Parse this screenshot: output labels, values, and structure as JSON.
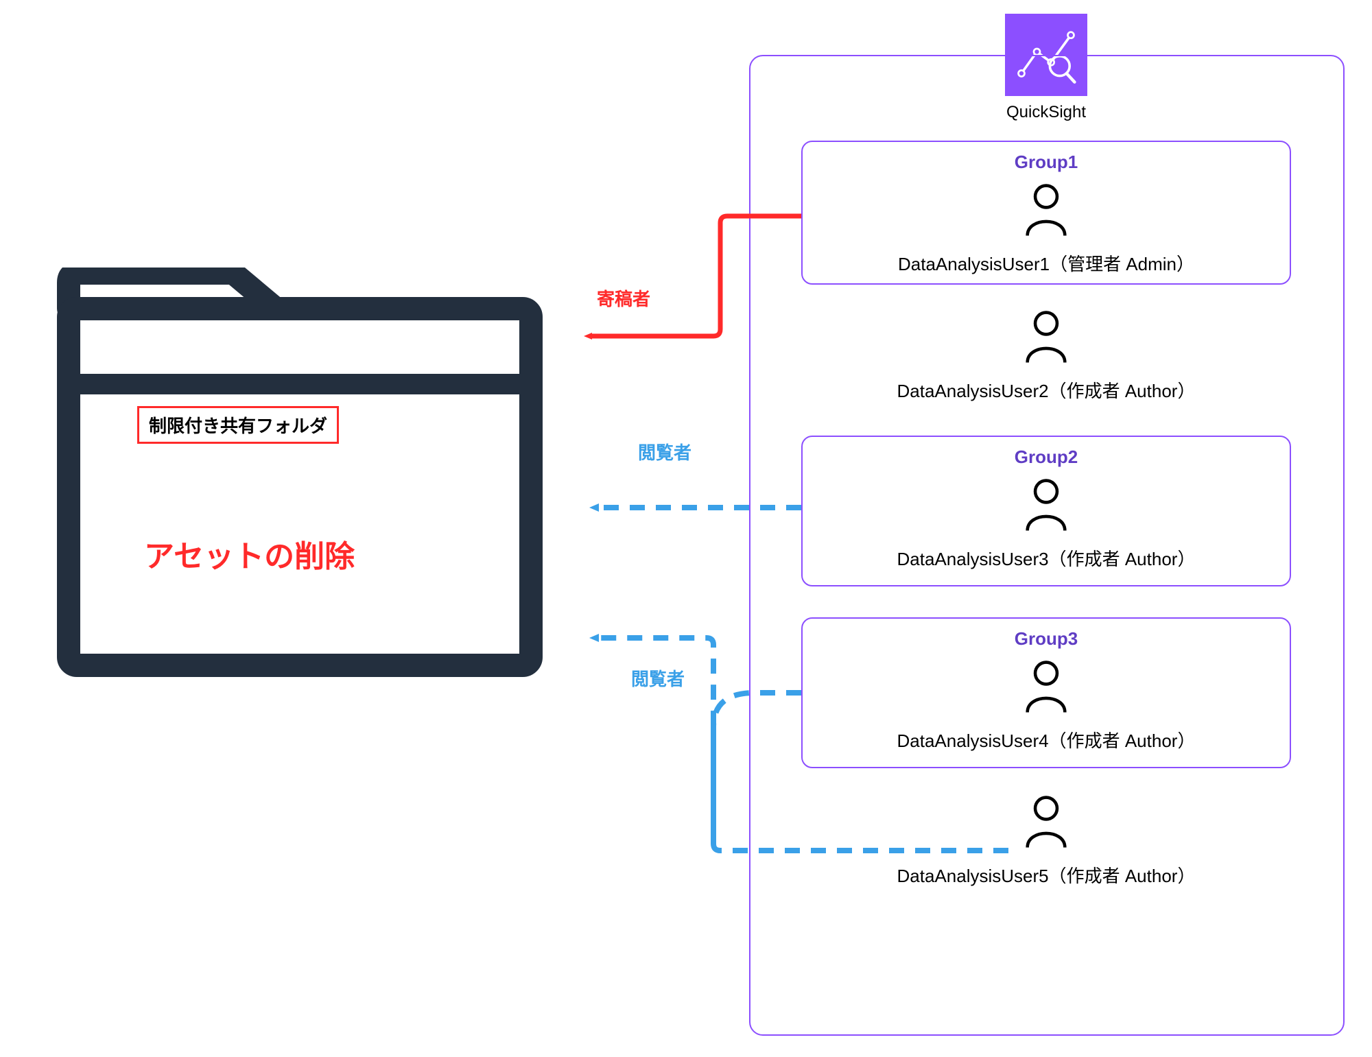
{
  "quicksight": {
    "label": "QuickSight",
    "groups": [
      {
        "title": "Group1",
        "user": "DataAnalysisUser1（管理者 Admin）"
      },
      {
        "title": "Group2",
        "user": "DataAnalysisUser3（作成者 Author）"
      },
      {
        "title": "Group3",
        "user": "DataAnalysisUser4（作成者 Author）"
      }
    ],
    "users": [
      {
        "label": "DataAnalysisUser2（作成者 Author）"
      },
      {
        "label": "DataAnalysisUser5（作成者 Author）"
      }
    ]
  },
  "folder": {
    "box_label": "制限付き共有フォルダ",
    "main_text": "アセットの削除"
  },
  "arrows": {
    "contributor": "寄稿者",
    "viewer1": "閲覧者",
    "viewer2": "閲覧者"
  },
  "colors": {
    "purple": "#8c4fff",
    "darkNavy": "#232f3e",
    "red": "#ff2a2a",
    "blue": "#3aa0e8"
  }
}
